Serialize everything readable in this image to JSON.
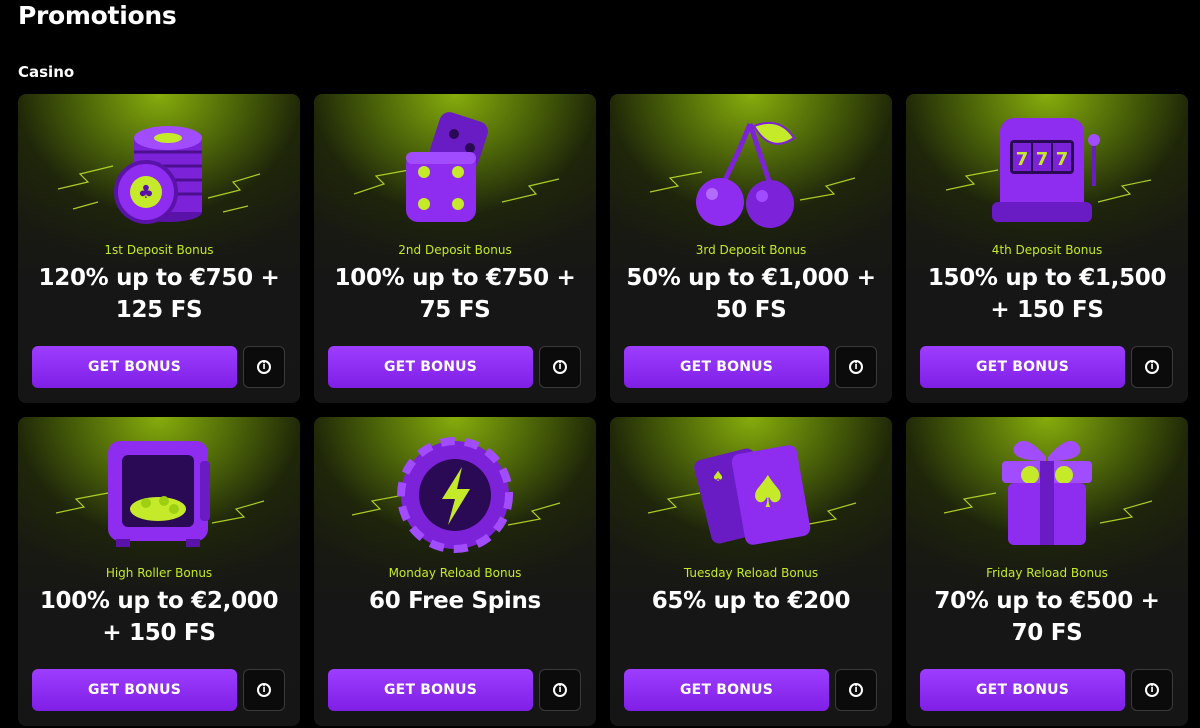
{
  "page": {
    "title": "Promotions",
    "section": "Casino"
  },
  "colors": {
    "accent_purple": "#8a2be2",
    "accent_lime": "#c4ea2a",
    "background": "#000000",
    "card": "#161616"
  },
  "promotions": [
    {
      "label": "1st Deposit Bonus",
      "offer": "120% up to €750 + 125 FS",
      "button": "GET BONUS",
      "icon": "casino-chips-icon"
    },
    {
      "label": "2nd Deposit Bonus",
      "offer": "100% up to €750 + 75 FS",
      "button": "GET BONUS",
      "icon": "dice-icon"
    },
    {
      "label": "3rd Deposit Bonus",
      "offer": "50% up to €1,000 + 50 FS",
      "button": "GET BONUS",
      "icon": "cherries-icon"
    },
    {
      "label": "4th Deposit Bonus",
      "offer": "150% up to €1,500 + 150 FS",
      "button": "GET BONUS",
      "icon": "slot-machine-icon"
    },
    {
      "label": "High Roller Bonus",
      "offer": "100% up to €2,000 + 150 FS",
      "button": "GET BONUS",
      "icon": "safe-icon"
    },
    {
      "label": "Monday Reload Bonus",
      "offer": "60 Free Spins",
      "button": "GET BONUS",
      "icon": "lightning-chip-icon"
    },
    {
      "label": "Tuesday Reload Bonus",
      "offer": "65% up to €200",
      "button": "GET BONUS",
      "icon": "playing-cards-icon"
    },
    {
      "label": "Friday Reload Bonus",
      "offer": "70% up to €500 + 70 FS",
      "button": "GET BONUS",
      "icon": "gift-box-icon"
    }
  ]
}
